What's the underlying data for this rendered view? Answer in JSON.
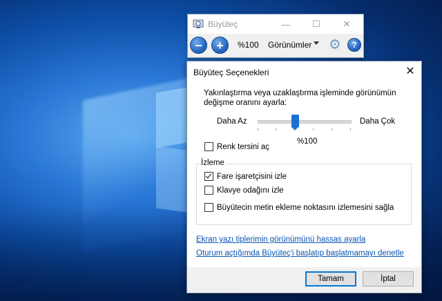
{
  "magnifier": {
    "title": "Büyüteç",
    "zoom_level": "%100",
    "views_label": "Görünümler",
    "icons": [
      "magnifier-app-icon",
      "zoom-out-icon",
      "zoom-in-icon",
      "gear-icon",
      "help-icon"
    ]
  },
  "dialog": {
    "title": "Büyüteç Seçenekleri",
    "description": "Yakınlaştırma veya uzaklaştırma işleminde görünümün değişme oranını ayarla:",
    "slider": {
      "min_label": "Daha Az",
      "max_label": "Daha Çok",
      "value_label": "%100"
    },
    "invert_colors": {
      "label": "Renk tersini aç",
      "checked": false
    },
    "tracking": {
      "title": "İzleme",
      "follow_mouse": {
        "label": "Fare işaretçisini izle",
        "checked": true
      },
      "follow_keyboard": {
        "label": "Klavye odağını izle",
        "checked": false
      },
      "follow_text": {
        "label": "Büyütecin metin ekleme noktasını izlemesini sağla",
        "checked": false
      }
    },
    "links": {
      "fonts": "Ekran yazı tiplerimin görünümünü hassas ayarla",
      "startup": "Oturum açtığımda Büyüteç'i başlatıp başlatmamayı denetle"
    },
    "buttons": {
      "ok": "Tamam",
      "cancel": "İptal"
    }
  },
  "colors": {
    "accent": "#0078d7",
    "link": "#0a54b3"
  }
}
